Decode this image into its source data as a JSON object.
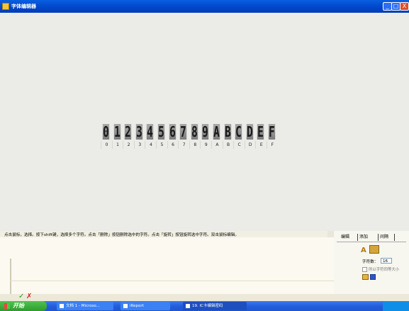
{
  "window": {
    "title": "字体编辑器",
    "buttons": {
      "minimize": "_",
      "maximize": "□",
      "close": "X"
    }
  },
  "glyphs": [
    {
      "char": "0",
      "label": "0"
    },
    {
      "char": "1",
      "label": "1"
    },
    {
      "char": "2",
      "label": "2"
    },
    {
      "char": "3",
      "label": "3"
    },
    {
      "char": "4",
      "label": "4"
    },
    {
      "char": "5",
      "label": "5"
    },
    {
      "char": "6",
      "label": "6"
    },
    {
      "char": "7",
      "label": "7"
    },
    {
      "char": "8",
      "label": "8"
    },
    {
      "char": "9",
      "label": "9"
    },
    {
      "char": "A",
      "label": "A"
    },
    {
      "char": "B",
      "label": "B"
    },
    {
      "char": "C",
      "label": "C"
    },
    {
      "char": "D",
      "label": "D"
    },
    {
      "char": "E",
      "label": "E"
    },
    {
      "char": "F",
      "label": "F"
    }
  ],
  "status": {
    "hint": "点击鼠标，选择。按下shift键，选择多个字符。点击「删除」按钮删除选中的字符。点击「旋转」按钮旋转选中字符。双击鼠标编辑。"
  },
  "panel": {
    "tabs": [
      "编辑",
      "添加",
      "间隔"
    ],
    "count_label": "字符数：",
    "count_value": "16",
    "same_size_label": "所以字符同等大小"
  },
  "actions": {
    "ok": "✓",
    "cancel": "✗"
  },
  "taskbar": {
    "start_label": "开始",
    "tasks": [
      "文档 1 - Microso...",
      "iReport",
      "19. IC卡编辑密码"
    ]
  },
  "colors": {
    "glyph_bg": "#8e8e8e",
    "canvas_bg": "#ebebe7",
    "titlebar": "#0045c8"
  }
}
